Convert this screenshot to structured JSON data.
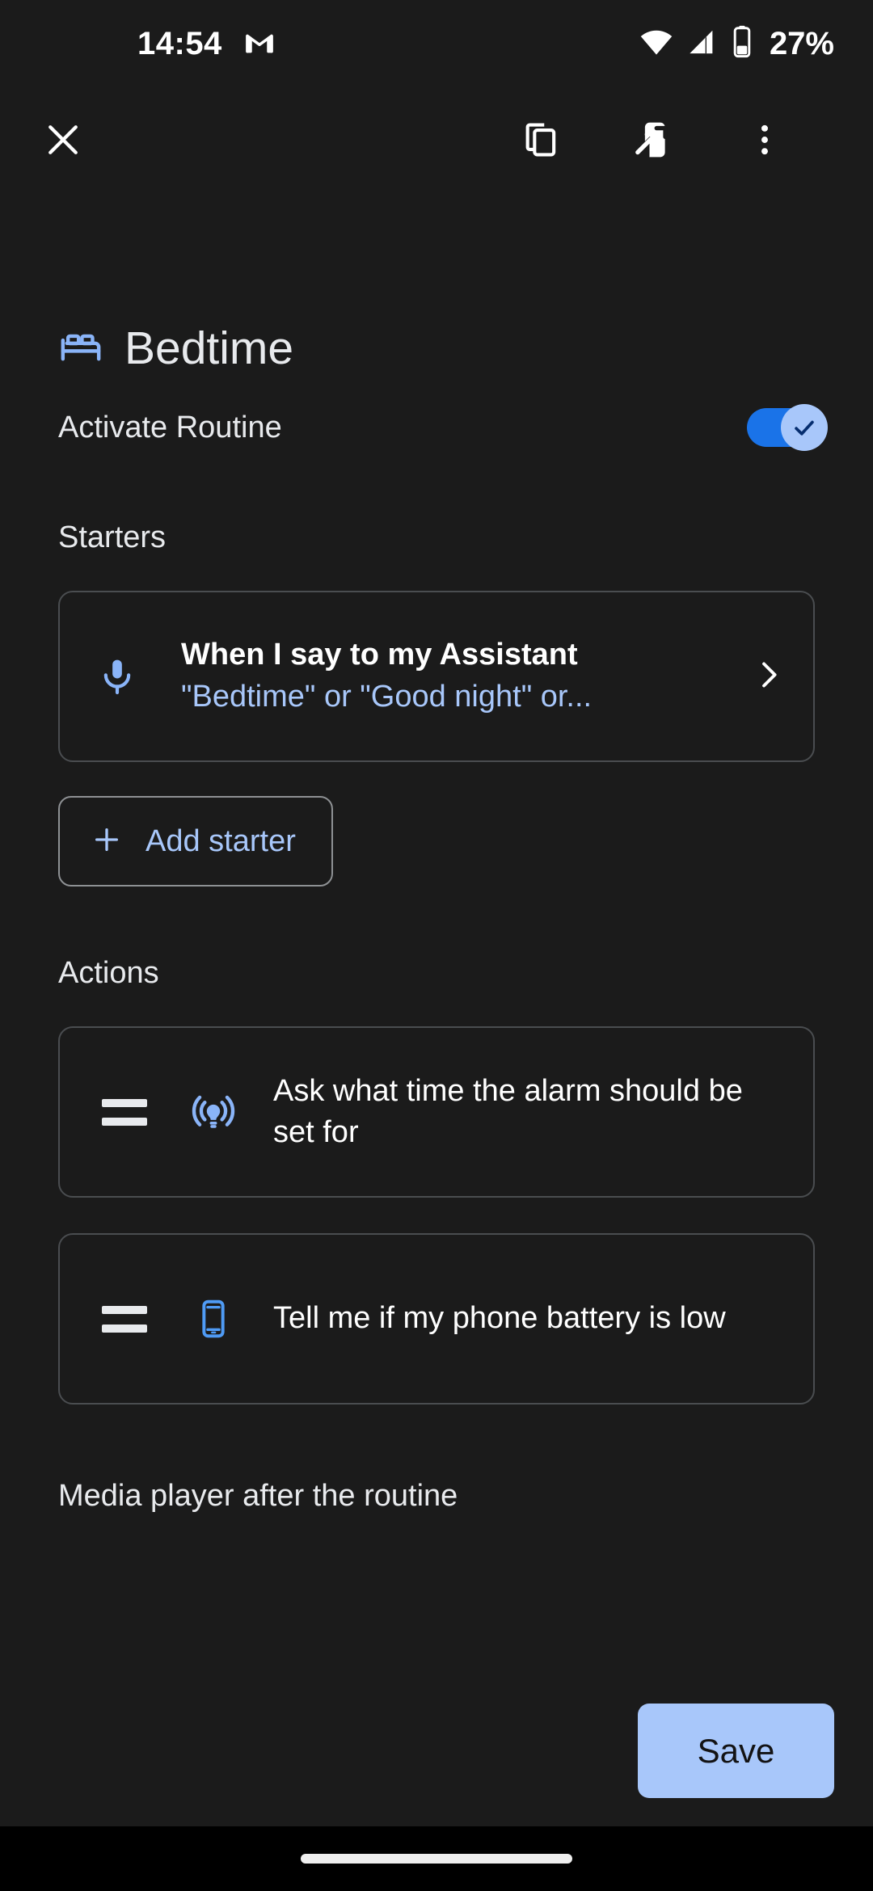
{
  "status_bar": {
    "time": "14:54",
    "battery_percent": "27%",
    "icons": [
      "gmail-icon",
      "wifi-icon",
      "cellular-signal-icon",
      "battery-icon"
    ]
  },
  "app_bar": {
    "close_icon": "close-icon",
    "duplicate_icon": "duplicate-icon",
    "send-to-device_icon": "send-to-device-icon",
    "overflow_icon": "more-vert-icon"
  },
  "routine": {
    "icon": "bed-icon",
    "title": "Bedtime",
    "activate_label": "Activate Routine",
    "activate_enabled": true
  },
  "starters": {
    "section_label": "Starters",
    "items": [
      {
        "icon": "microphone-icon",
        "title": "When I say to my Assistant",
        "subtitle": "\"Bedtime\" or \"Good night\" or...",
        "chevron": "chevron-right-icon"
      }
    ],
    "add_label": "Add starter",
    "add_icon": "plus-icon"
  },
  "actions": {
    "section_label": "Actions",
    "items": [
      {
        "drag_handle": "drag-handle-icon",
        "icon": "assistant-broadcast-icon",
        "text": "Ask what time the alarm should be set for"
      },
      {
        "drag_handle": "drag-handle-icon",
        "icon": "phone-icon",
        "text": "Tell me if my phone battery is low"
      }
    ]
  },
  "cutoff_section_label": "Media player after the routine",
  "bottom_bar": {
    "save_label": "Save"
  },
  "nav_bar": {
    "handle": "gesture-home-handle"
  },
  "colors": {
    "background": "#1b1b1b",
    "accent_blue": "#a8c7fa",
    "toggle_track": "#1a73e8",
    "text_primary": "#e8eaed",
    "card_border": "#4a4d50",
    "nav_background": "#000000"
  }
}
